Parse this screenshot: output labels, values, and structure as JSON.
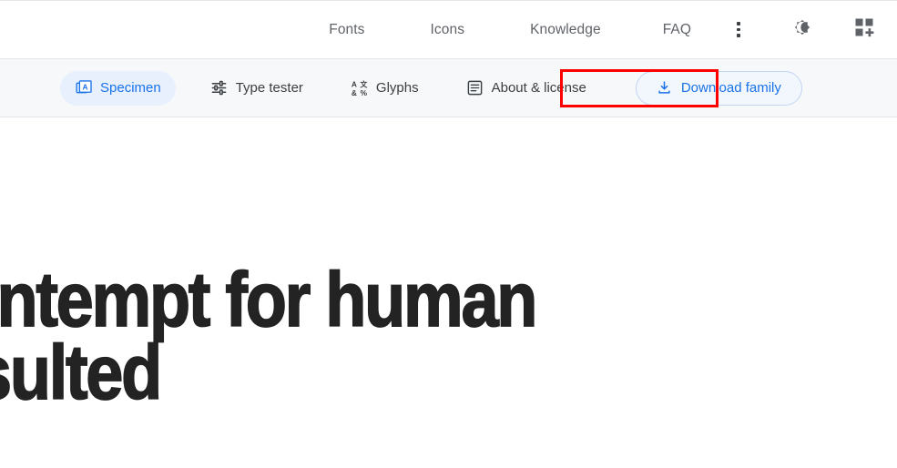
{
  "header": {
    "nav_items": [
      {
        "label": "Fonts",
        "name": "nav-fonts"
      },
      {
        "label": "Icons",
        "name": "nav-icons"
      },
      {
        "label": "Knowledge",
        "name": "nav-knowledge"
      },
      {
        "label": "FAQ",
        "name": "nav-faq"
      }
    ],
    "icons": {
      "overflow_menu": "more-vert-icon",
      "theme_toggle": "brightness-dark-mode-icon",
      "add_to_collection": "add-to-collection-icon"
    },
    "background": "#ffffff",
    "text_color": "#5f6368"
  },
  "sub_nav": {
    "background": "#f6f8fa",
    "active_tab_background": "#e8f0fe",
    "accent_color": "#1a73e8",
    "tabs": [
      {
        "label": "Specimen",
        "icon": "specimen-icon",
        "active": true
      },
      {
        "label": "Type tester",
        "icon": "tune-sliders-icon",
        "active": false
      },
      {
        "label": "Glyphs",
        "icon": "glyphs-grid-icon",
        "active": false
      },
      {
        "label": "About & license",
        "icon": "article-icon",
        "active": false
      }
    ],
    "download": {
      "label": "Download family",
      "icon": "download-icon",
      "border_color": "#c3d5f2",
      "text_color": "#1a73e8"
    }
  },
  "annotation": {
    "highlight_color": "#ff0000",
    "target": "Download family"
  },
  "specimen": {
    "text": "and contempt for human\nave resulted",
    "color": "#232323"
  }
}
